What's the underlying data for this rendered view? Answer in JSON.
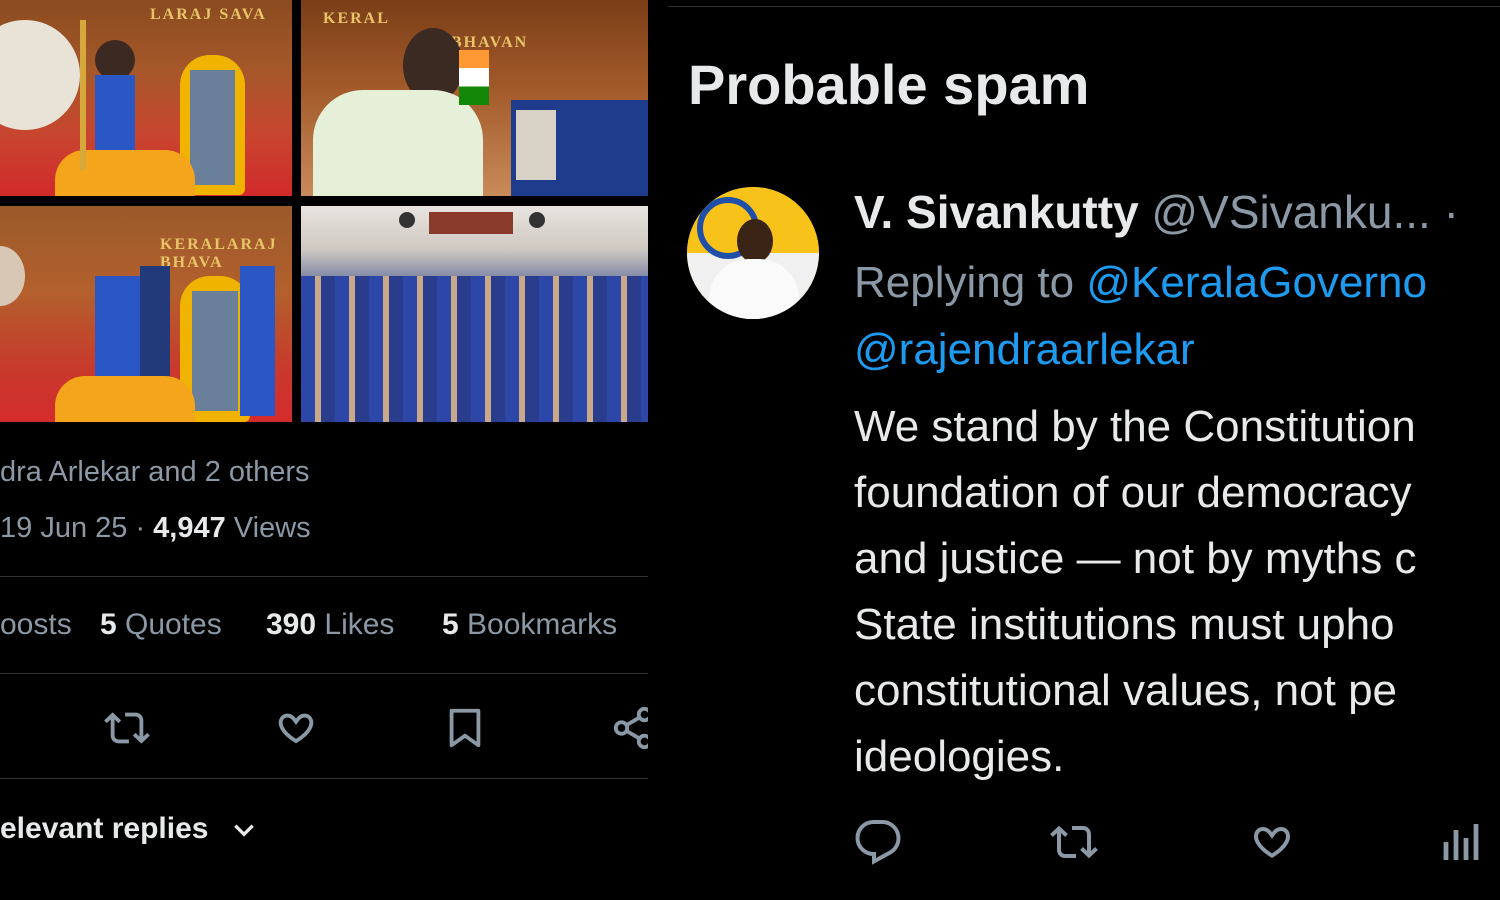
{
  "left_panel": {
    "photo_signs": {
      "p1": "LARAJ SAVA",
      "p2a": "KERAL",
      "p2b": "BHAVAN",
      "p3": "KERALARAJ BHAVA"
    },
    "liked_by_text": "dra Arlekar and 2 others",
    "meta": {
      "time": "19 Jun 25",
      "separator": " · ",
      "views_count": "4,947",
      "views_label": " Views"
    },
    "counts": [
      {
        "count": "",
        "label": "oosts"
      },
      {
        "count": "5",
        "label": " Quotes"
      },
      {
        "count": "390",
        "label": " Likes"
      },
      {
        "count": "5",
        "label": " Bookmarks"
      }
    ],
    "actions": [
      "retweet-icon",
      "heart-icon",
      "bookmark-icon",
      "share-icon"
    ],
    "replies_filter": "elevant replies"
  },
  "right_panel": {
    "heading": "Probable spam",
    "author": {
      "name": "V. Sivankutty",
      "handle": " @VSivanku...",
      "dot": " ·"
    },
    "replying_label": "Replying to ",
    "mention_1": "@KeralaGoverno",
    "mention_2": "@rajendraarlekar",
    "text_lines": [
      "We stand by the Constitution",
      "foundation of our democracy",
      "and justice — not by myths c",
      "State institutions must upho",
      "constitutional values, not pe",
      "ideologies."
    ],
    "actions": [
      "reply-icon",
      "retweet-icon",
      "heart-icon",
      "views-icon"
    ],
    "colors": {
      "link": "#1d9bf0",
      "muted": "#8b98a5",
      "text": "#e7e9ea"
    }
  }
}
